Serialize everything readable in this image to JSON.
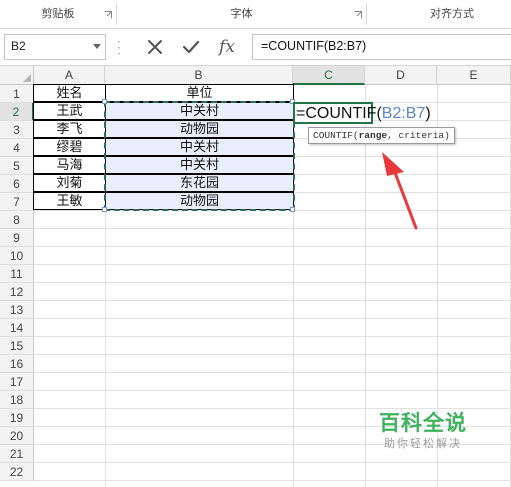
{
  "ribbon": {
    "groups": [
      "剪贴板",
      "字体",
      "对齐方式"
    ]
  },
  "formula_bar": {
    "name_box": "B2",
    "cancel_icon": "x-icon",
    "enter_icon": "check-icon",
    "fx_label": "fx",
    "formula": "=COUNTIF(B2:B7)"
  },
  "columns": [
    "A",
    "B",
    "C",
    "D",
    "E"
  ],
  "rows": [
    "1",
    "2",
    "3",
    "4",
    "5",
    "6",
    "7",
    "8",
    "9",
    "10",
    "11",
    "12",
    "13",
    "14",
    "15",
    "16",
    "17",
    "18",
    "19",
    "20",
    "21",
    "22"
  ],
  "table": {
    "header": {
      "name": "姓名",
      "unit": "单位"
    },
    "records": [
      {
        "name": "王武",
        "unit": "中关村"
      },
      {
        "name": "李飞",
        "unit": "动物园"
      },
      {
        "name": "缪碧",
        "unit": "中关村"
      },
      {
        "name": "马海",
        "unit": "中关村"
      },
      {
        "name": "刘菊",
        "unit": "东花园"
      },
      {
        "name": "王敏",
        "unit": "动物园"
      }
    ]
  },
  "editing": {
    "prefix": "=COUNTIF(",
    "ref": "B2:B7",
    "suffix": ")",
    "tooltip_fn": "COUNTIF(",
    "tooltip_arg1": "range",
    "tooltip_rest": ", criteria)"
  },
  "watermark": {
    "title": "百科全说",
    "subtitle": "助你轻松解决"
  },
  "colors": {
    "accent": "#217346",
    "reference": "#5b86c9",
    "arrow": "#e8393c",
    "watermark": "#3fb25e"
  }
}
